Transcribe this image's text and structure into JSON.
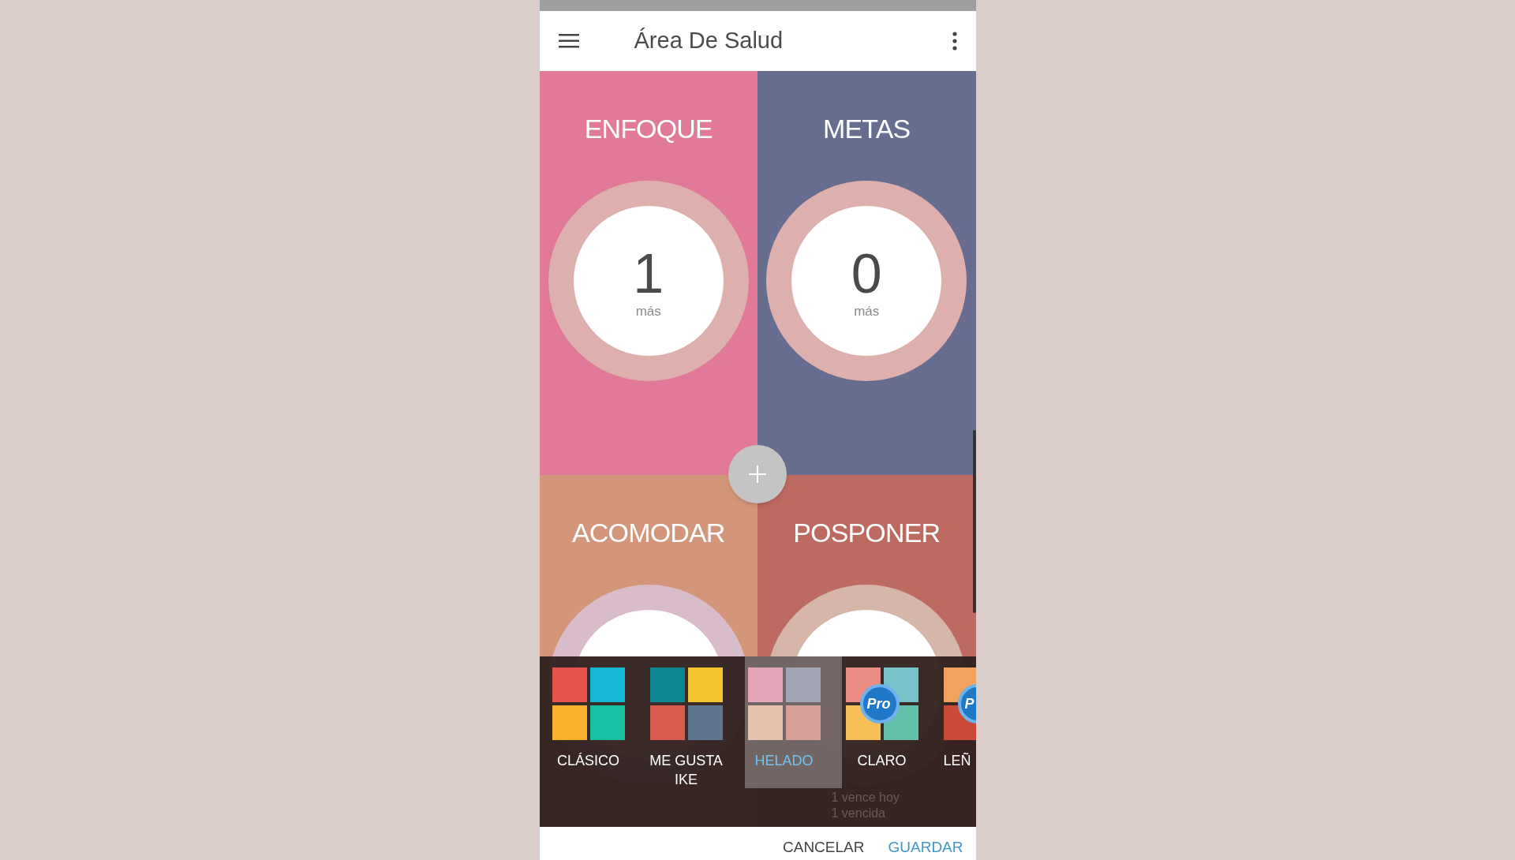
{
  "app_bar": {
    "title": "Área De Salud"
  },
  "tiles": [
    {
      "title": "ENFOQUE",
      "count": "1",
      "unit": "más",
      "color": "#e07a98",
      "ring": {
        "color": "#ddb0ad"
      }
    },
    {
      "title": "METAS",
      "count": "0",
      "unit": "más",
      "color": "#676d8f",
      "ring": {
        "color": "#ddb0ad"
      }
    },
    {
      "title": "ACOMODAR",
      "color": "#d4967a",
      "ring": {
        "color": "#d9bcca"
      }
    },
    {
      "title": "POSPONER",
      "color": "#bd6a60",
      "ring": {
        "color": "#d5b6a8"
      }
    }
  ],
  "themes": [
    {
      "label": "CLÁSICO",
      "selected": false,
      "swatches": [
        {
          "color": "#e8524c"
        },
        {
          "color": "#14b8d6"
        },
        {
          "color": "#f8b02d"
        },
        {
          "color": "#17c0a0"
        }
      ]
    },
    {
      "label": "ME GUSTA IKE",
      "selected": false,
      "swatches": [
        {
          "color": "#0f8790"
        },
        {
          "color": "#f5c431"
        },
        {
          "color": "#d85b4f"
        },
        {
          "color": "#5f7691"
        }
      ]
    },
    {
      "label": "HELADO",
      "selected": true,
      "swatches": [
        {
          "color": "#e5a5b8"
        },
        {
          "color": "#a3a4b6"
        },
        {
          "color": "#e6c1ad"
        },
        {
          "color": "#d7a097"
        }
      ]
    },
    {
      "label": "CLARO",
      "selected": false,
      "badge": "Pro",
      "swatches": [
        {
          "color": "#ec8d85"
        },
        {
          "color": "#77c1c8"
        },
        {
          "color": "#f6c058"
        },
        {
          "color": "#63c1ab"
        }
      ]
    },
    {
      "label": "LEÑ",
      "selected": false,
      "badge": "P",
      "swatches": [
        {
          "color": "#efa35c"
        },
        {
          "color": "#c94a38"
        }
      ]
    }
  ],
  "footer_note": [
    "1 vence hoy",
    "1 vencida"
  ],
  "buttons": [
    {
      "label": "CANCELAR",
      "kind": "plain"
    },
    {
      "label": "GUARDAR",
      "kind": "primary"
    }
  ]
}
